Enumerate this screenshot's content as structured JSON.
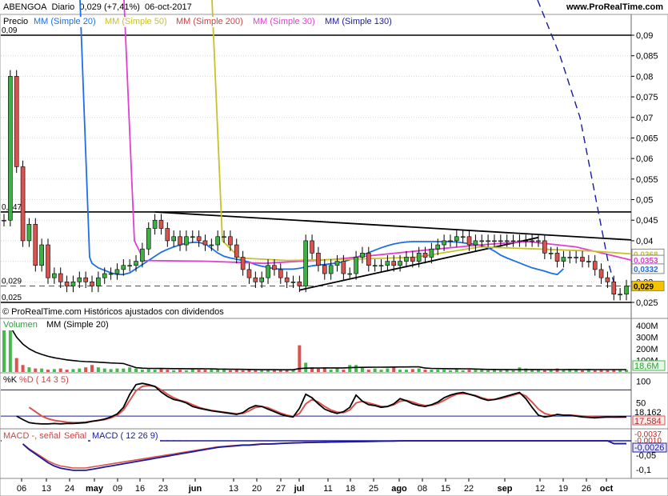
{
  "header": {
    "instrument": "ABENGOA",
    "period": "Diario",
    "last": "0,029 (+7,41%)",
    "date": "06-oct-2017",
    "site": "www.ProRealTime.com"
  },
  "legend": {
    "price": "Precio",
    "ma20": "MM (Simple 20)",
    "ma50": "MM (Simple 50)",
    "ma200": "MM (Simple 200)",
    "ma30": "MM (Simple 30)",
    "ma130": "MM (Simple 130)",
    "copyright": "© ProRealTime.com  Históricos ajustados con dividendos",
    "volume": "Volumen",
    "vol_ma": "MM (Simple 20)",
    "k": "%K",
    "d": "%D ( 14 3 5)",
    "macd": "MACD -, señal",
    "signal": "Señal",
    "macd_params": "MACD ( 12 26 9)"
  },
  "colors": {
    "up": "#3cb043",
    "down": "#d9534f",
    "ma20": "#1e6fe6",
    "ma50": "#c9c12a",
    "ma200": "#cc4444",
    "ma30": "#e040d0",
    "ma130": "#1a1aa0",
    "last_price": "#f5c400",
    "grid": "#cfd8e0"
  },
  "price_axis": [
    "0,09",
    "0,085",
    "0,08",
    "0,075",
    "0,07",
    "0,065",
    "0,06",
    "0,055",
    "0,05",
    "0,045",
    "0,04",
    "0,035",
    "0,03",
    "0,025"
  ],
  "price_tags": {
    "ma50": "0,0368",
    "ma30": "0,0353",
    "ma20": "0,0332",
    "last": "0,029",
    "hline_09": "0,09",
    "hline_047": "0,047",
    "hline_029": "0,029",
    "hline_025": "0,025"
  },
  "volume_axis": [
    "400M",
    "300M",
    "200M",
    "100M"
  ],
  "volume_tag": "18,6M",
  "stoch_axis": [
    "100",
    "50"
  ],
  "stoch_tags": {
    "k": "18,162",
    "d": "17,584"
  },
  "macd_axis": [
    "-0,05",
    "-0,1"
  ],
  "macd_tags": {
    "macd": "-0,0037",
    "signal": "-0,0010",
    "hist": "-0,0026"
  },
  "x_axis": [
    "06",
    "13",
    "24",
    "may",
    "09",
    "16",
    "23",
    "jun",
    "13",
    "20",
    "27",
    "jul",
    "11",
    "18",
    "25",
    "ago",
    "08",
    "15",
    "22",
    "sep",
    "12",
    "19",
    "26",
    "oct"
  ],
  "chart_data": {
    "type": "candlestick",
    "ylim": [
      0.025,
      0.09
    ],
    "hlines": [
      0.09,
      0.047,
      0.029,
      0.025
    ],
    "close": [
      0.045,
      0.08,
      0.058,
      0.04,
      0.044,
      0.034,
      0.039,
      0.031,
      0.032,
      0.03,
      0.029,
      0.03,
      0.031,
      0.03,
      0.029,
      0.031,
      0.032,
      0.032,
      0.033,
      0.034,
      0.034,
      0.035,
      0.038,
      0.043,
      0.045,
      0.043,
      0.04,
      0.041,
      0.039,
      0.041,
      0.041,
      0.04,
      0.039,
      0.039,
      0.041,
      0.041,
      0.039,
      0.036,
      0.033,
      0.031,
      0.03,
      0.031,
      0.034,
      0.033,
      0.031,
      0.03,
      0.03,
      0.029,
      0.04,
      0.037,
      0.034,
      0.032,
      0.034,
      0.035,
      0.032,
      0.032,
      0.036,
      0.037,
      0.034,
      0.034,
      0.034,
      0.035,
      0.034,
      0.035,
      0.036,
      0.035,
      0.037,
      0.036,
      0.038,
      0.039,
      0.04,
      0.04,
      0.041,
      0.041,
      0.039,
      0.04,
      0.04,
      0.04,
      0.04,
      0.04,
      0.04,
      0.04,
      0.04,
      0.04,
      0.04,
      0.04,
      0.037,
      0.037,
      0.035,
      0.036,
      0.036,
      0.036,
      0.035,
      0.035,
      0.033,
      0.031,
      0.03,
      0.027,
      0.027,
      0.029
    ],
    "ma20": [
      null,
      null,
      null,
      null,
      null,
      null,
      null,
      null,
      null,
      null,
      null,
      null,
      null,
      null,
      0.0345,
      0.0334,
      0.0328,
      0.0322,
      0.0318,
      0.0318,
      0.0322,
      0.0332,
      0.0342,
      0.0352,
      0.0362,
      0.0372,
      0.0379,
      0.0385,
      0.039,
      0.0394,
      0.0396,
      0.0396,
      0.0392,
      0.0382,
      0.037,
      0.0362,
      0.0358,
      0.0355,
      0.0352,
      0.0348,
      0.0342,
      0.0338,
      0.0335,
      0.0332,
      0.0331,
      0.0331,
      0.0331,
      0.0333,
      0.0336,
      0.0339,
      0.0341,
      0.0342,
      0.0344,
      0.0346,
      0.0349,
      0.0354,
      0.0359,
      0.0365,
      0.0371,
      0.0377,
      0.0383,
      0.0388,
      0.0392,
      0.0395,
      0.0397,
      0.0398,
      0.0398,
      0.0398,
      0.0398,
      0.0398,
      0.0398,
      0.0398,
      0.0397,
      0.0395,
      0.0393,
      0.0391,
      0.0388,
      0.0383,
      0.0375,
      0.0365,
      0.0358,
      0.0352,
      0.0346,
      0.034,
      0.0334,
      0.033,
      0.0326,
      0.0321,
      0.0318,
      0.0332
    ],
    "ma30_end": 0.0353,
    "ma50_end": 0.0368,
    "volume_millions": [
      400,
      380,
      120,
      60,
      40,
      30,
      30,
      20,
      25,
      30,
      20,
      25,
      30,
      40,
      60,
      40,
      30,
      25,
      30,
      30,
      40,
      30,
      20,
      25,
      20,
      30,
      20,
      15,
      20,
      15,
      25,
      20,
      20,
      30,
      25,
      20,
      15,
      20,
      15,
      20,
      15,
      15,
      20,
      15,
      15,
      20,
      20,
      230,
      80,
      40,
      30,
      40,
      20,
      30,
      20,
      60,
      60,
      40,
      20,
      30,
      20,
      30,
      40,
      20,
      20,
      25,
      30,
      20,
      20,
      20,
      20,
      15,
      25,
      15,
      20,
      20,
      20,
      15,
      20,
      15,
      20,
      15,
      40,
      30,
      25,
      20,
      15,
      15,
      30,
      20,
      25,
      20,
      15,
      20,
      15,
      20,
      15,
      20,
      20,
      18.6
    ],
    "stoch_k": [
      null,
      null,
      20,
      12,
      5,
      3,
      2,
      2,
      3,
      2,
      3,
      3,
      4,
      5,
      8,
      10,
      13,
      18,
      25,
      40,
      70,
      92,
      95,
      92,
      88,
      75,
      65,
      58,
      55,
      50,
      42,
      38,
      35,
      32,
      30,
      28,
      26,
      24,
      28,
      38,
      44,
      42,
      36,
      30,
      24,
      20,
      18,
      38,
      70,
      62,
      48,
      36,
      30,
      26,
      30,
      40,
      68,
      54,
      46,
      44,
      40,
      42,
      48,
      60,
      55,
      48,
      44,
      42,
      46,
      52,
      62,
      68,
      72,
      74,
      70,
      66,
      60,
      56,
      58,
      62,
      66,
      70,
      74,
      60,
      40,
      22,
      18,
      20,
      24,
      22,
      22,
      20,
      18,
      17,
      16,
      17,
      18,
      17.6,
      18,
      18.16
    ],
    "stoch_d": [
      null,
      null,
      null,
      null,
      40,
      30,
      20,
      14,
      10,
      8,
      6,
      5,
      5,
      6,
      8,
      10,
      12,
      16,
      22,
      34,
      56,
      78,
      88,
      90,
      88,
      80,
      70,
      62,
      56,
      52,
      46,
      40,
      36,
      33,
      31,
      29,
      27,
      25,
      26,
      32,
      40,
      42,
      39,
      33,
      27,
      22,
      19,
      26,
      48,
      58,
      52,
      42,
      34,
      29,
      28,
      34,
      50,
      54,
      50,
      46,
      42,
      42,
      46,
      54,
      56,
      52,
      47,
      44,
      45,
      49,
      56,
      64,
      70,
      72,
      70,
      67,
      62,
      58,
      58,
      60,
      64,
      68,
      72,
      66,
      52,
      36,
      26,
      22,
      22,
      22,
      22,
      21,
      20,
      19,
      18,
      18,
      18,
      17.7,
      17.6,
      17.58
    ],
    "macd": [
      null,
      null,
      null,
      -0.003,
      -0.008,
      -0.012,
      -0.016,
      -0.02,
      -0.023,
      -0.025,
      -0.026,
      -0.027,
      -0.027,
      -0.027,
      -0.026,
      -0.025,
      -0.024,
      -0.023,
      -0.022,
      -0.021,
      -0.02,
      -0.019,
      -0.018,
      -0.017,
      -0.016,
      -0.015,
      -0.014,
      -0.013,
      -0.012,
      -0.011,
      -0.01,
      -0.009,
      -0.008,
      -0.007,
      -0.006,
      -0.0055,
      -0.005,
      -0.0045,
      -0.004,
      -0.004,
      -0.0035,
      -0.003,
      -0.003,
      -0.0028,
      -0.0025,
      -0.0022,
      -0.002,
      -0.0018,
      -0.0016,
      -0.0015,
      -0.0014,
      -0.0013,
      -0.0012,
      -0.0011,
      -0.001,
      -0.0009,
      -0.0008,
      -0.0007,
      -0.0006,
      -0.0005,
      -0.0004,
      -0.0003,
      -0.0002,
      -0.0001,
      0,
      0,
      0,
      0,
      0,
      0,
      0,
      0,
      0,
      0,
      0,
      0,
      0,
      0,
      0,
      0,
      0,
      0,
      0,
      0,
      0,
      0,
      0,
      0,
      0,
      0,
      0,
      0,
      0,
      0,
      0,
      0,
      0,
      -0.0026,
      -0.0026,
      -0.0026
    ]
  }
}
